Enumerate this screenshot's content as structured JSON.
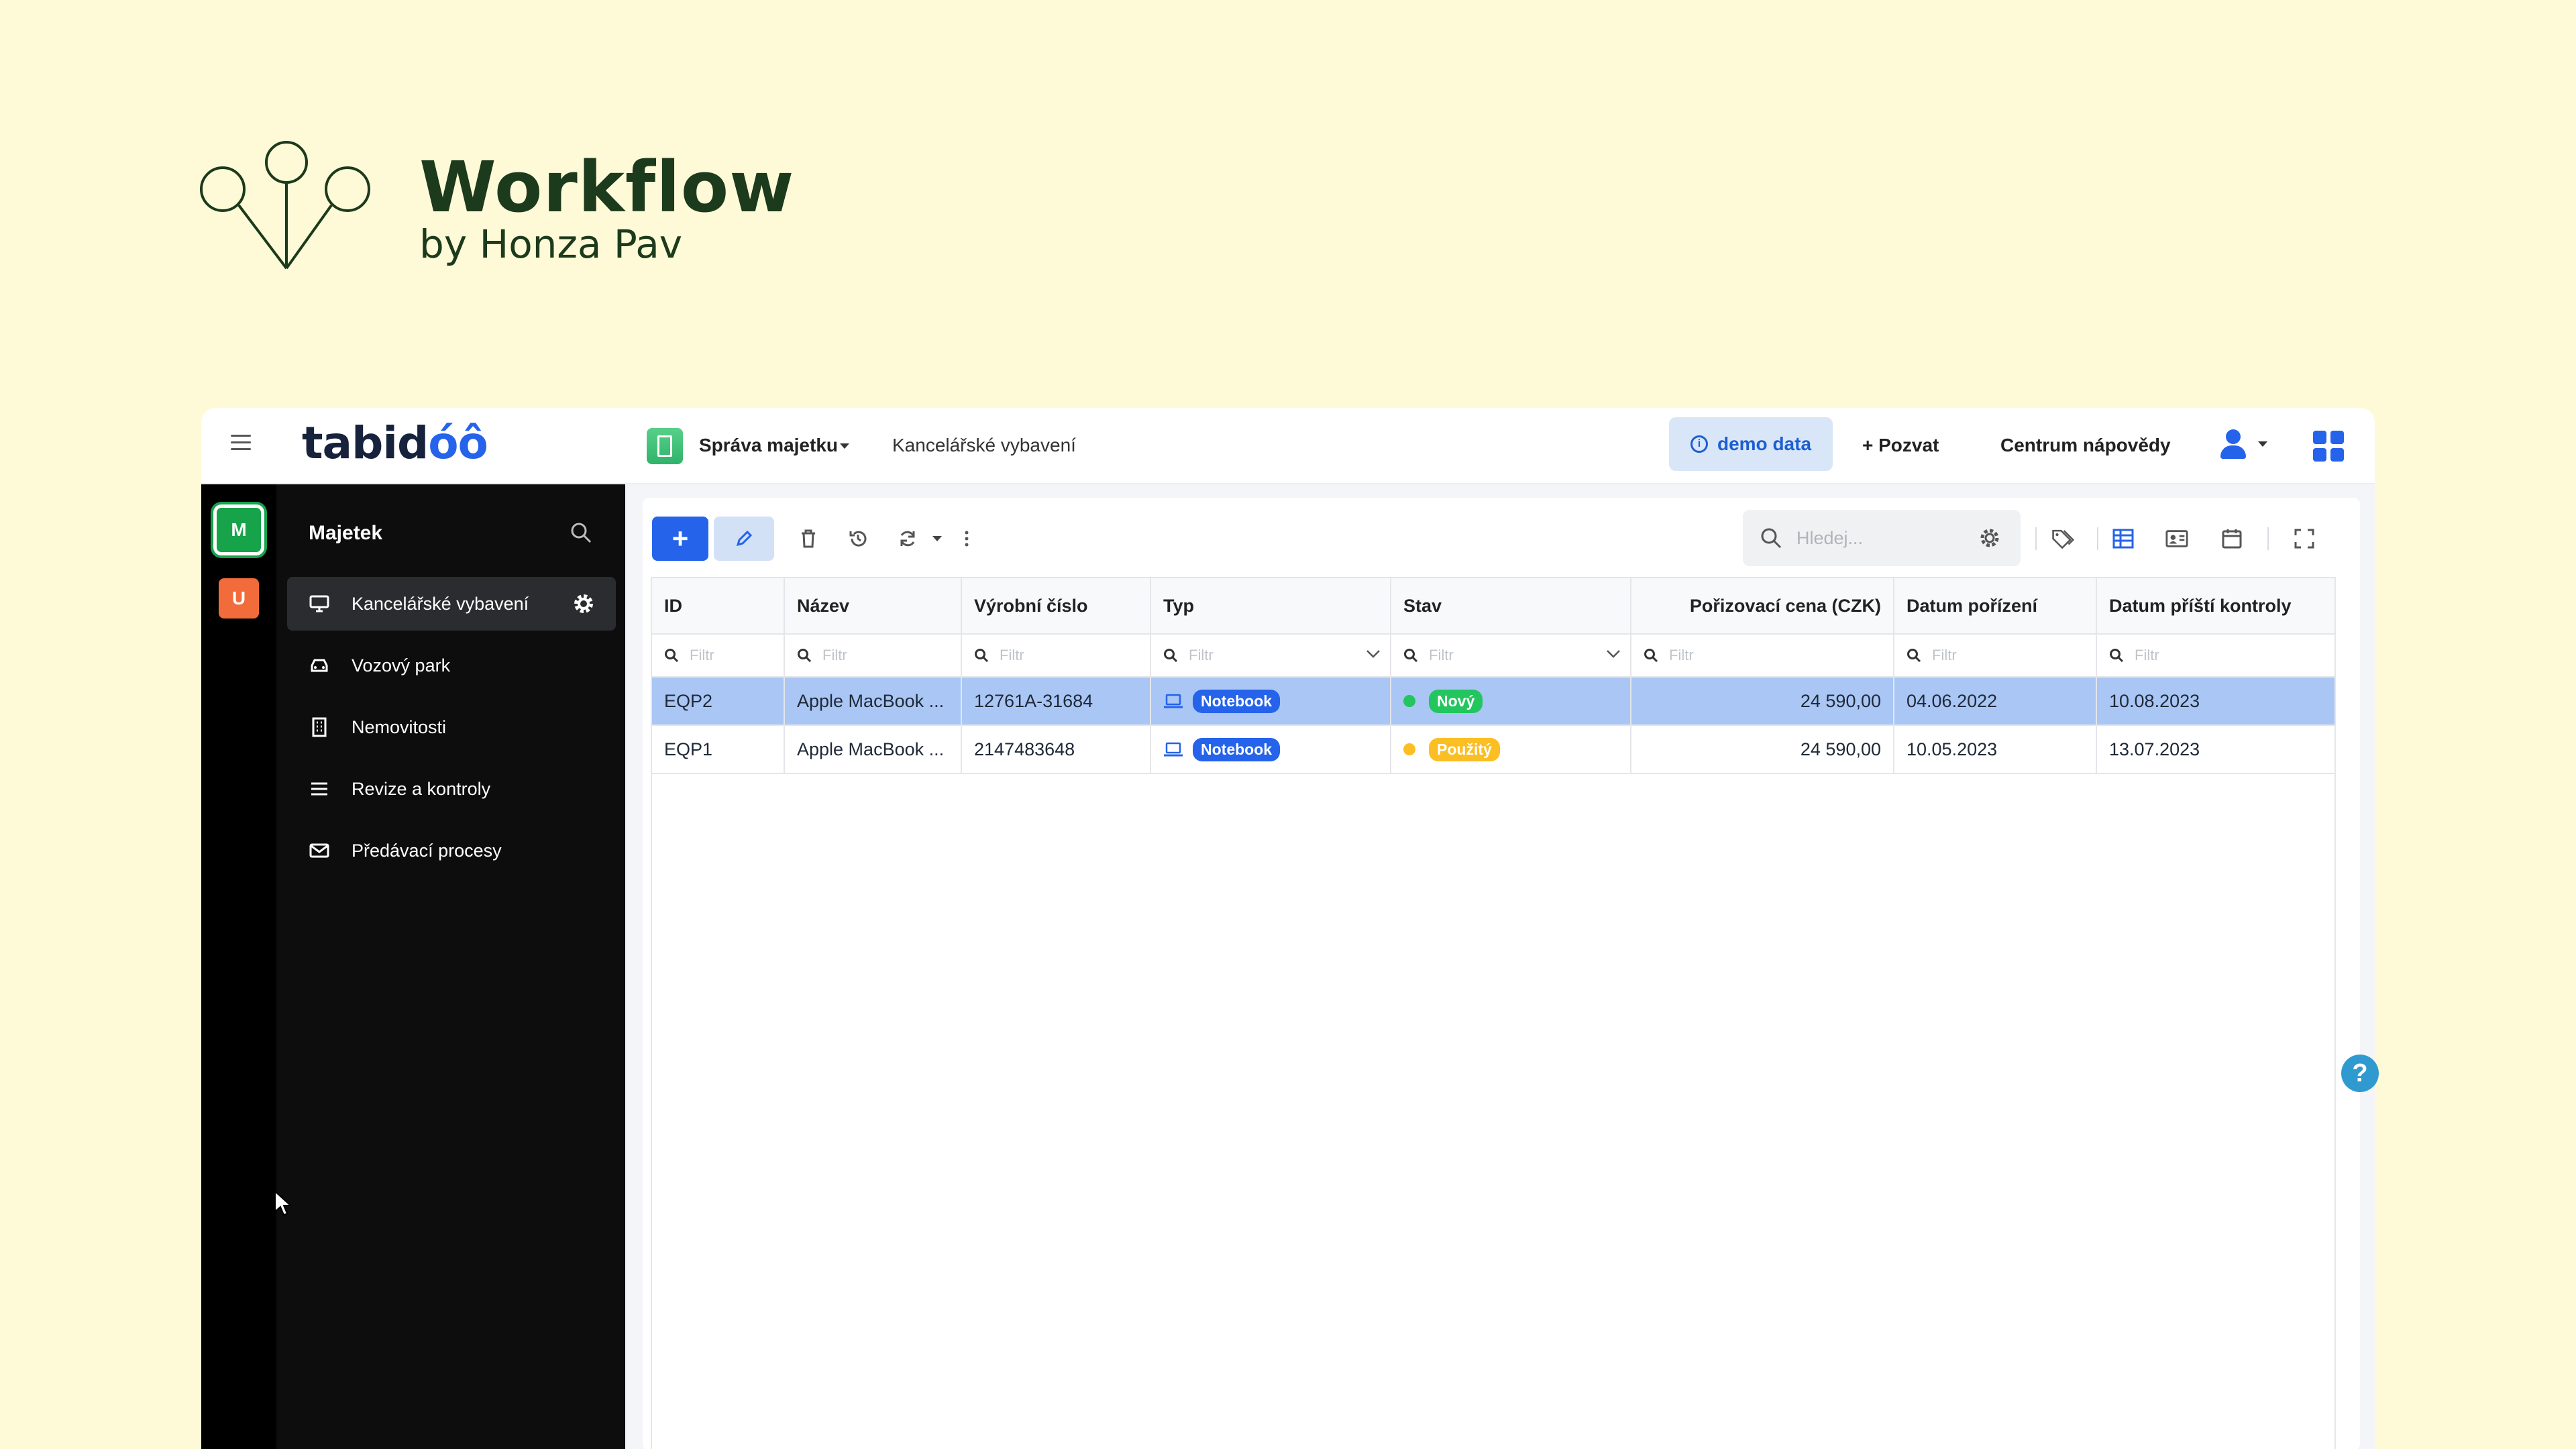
{
  "brand": {
    "title": "Workflow",
    "subtitle": "by Honza Pav"
  },
  "app": {
    "logo_text_a": "tabid",
    "logo_text_b": "óô",
    "module": "Správa majetku",
    "breadcrumb": "Kancelářské vybavení",
    "demo_label": "demo data",
    "invite_label": "+ Pozvat",
    "help_center": "Centrum nápovědy"
  },
  "workspaces": [
    {
      "letter": "M",
      "color": "#16a34a"
    },
    {
      "letter": "U",
      "color": "#f26b3a"
    }
  ],
  "sidebar": {
    "title": "Majetek",
    "items": [
      {
        "label": "Kancelářské vybavení",
        "icon": "monitor-icon",
        "active": true
      },
      {
        "label": "Vozový park",
        "icon": "car-icon"
      },
      {
        "label": "Nemovitosti",
        "icon": "building-icon"
      },
      {
        "label": "Revize a kontroly",
        "icon": "list-icon"
      },
      {
        "label": "Předávací procesy",
        "icon": "mail-icon"
      }
    ]
  },
  "search": {
    "placeholder": "Hledej..."
  },
  "table": {
    "columns": [
      "ID",
      "Název",
      "Výrobní číslo",
      "Typ",
      "Stav",
      "Pořizovací cena (CZK)",
      "Datum pořízení",
      "Datum příští kontroly"
    ],
    "filter_placeholder": "Filtr",
    "rows": [
      {
        "id": "EQP2",
        "name": "Apple MacBook ...",
        "serial": "12761A-31684",
        "type": "Notebook",
        "status": "Nový",
        "status_color": "#22c55e",
        "price": "24 590,00",
        "bought": "04.06.2022",
        "next_check": "10.08.2023",
        "selected": true
      },
      {
        "id": "EQP1",
        "name": "Apple MacBook ...",
        "serial": "2147483648",
        "type": "Notebook",
        "status": "Použitý",
        "status_color": "#fbbf24",
        "price": "24 590,00",
        "bought": "10.05.2023",
        "next_check": "13.07.2023",
        "selected": false
      }
    ]
  },
  "colors": {
    "accent": "#2563eb",
    "selected_row": "#a9c6f5",
    "type_badge": "#2563eb"
  }
}
